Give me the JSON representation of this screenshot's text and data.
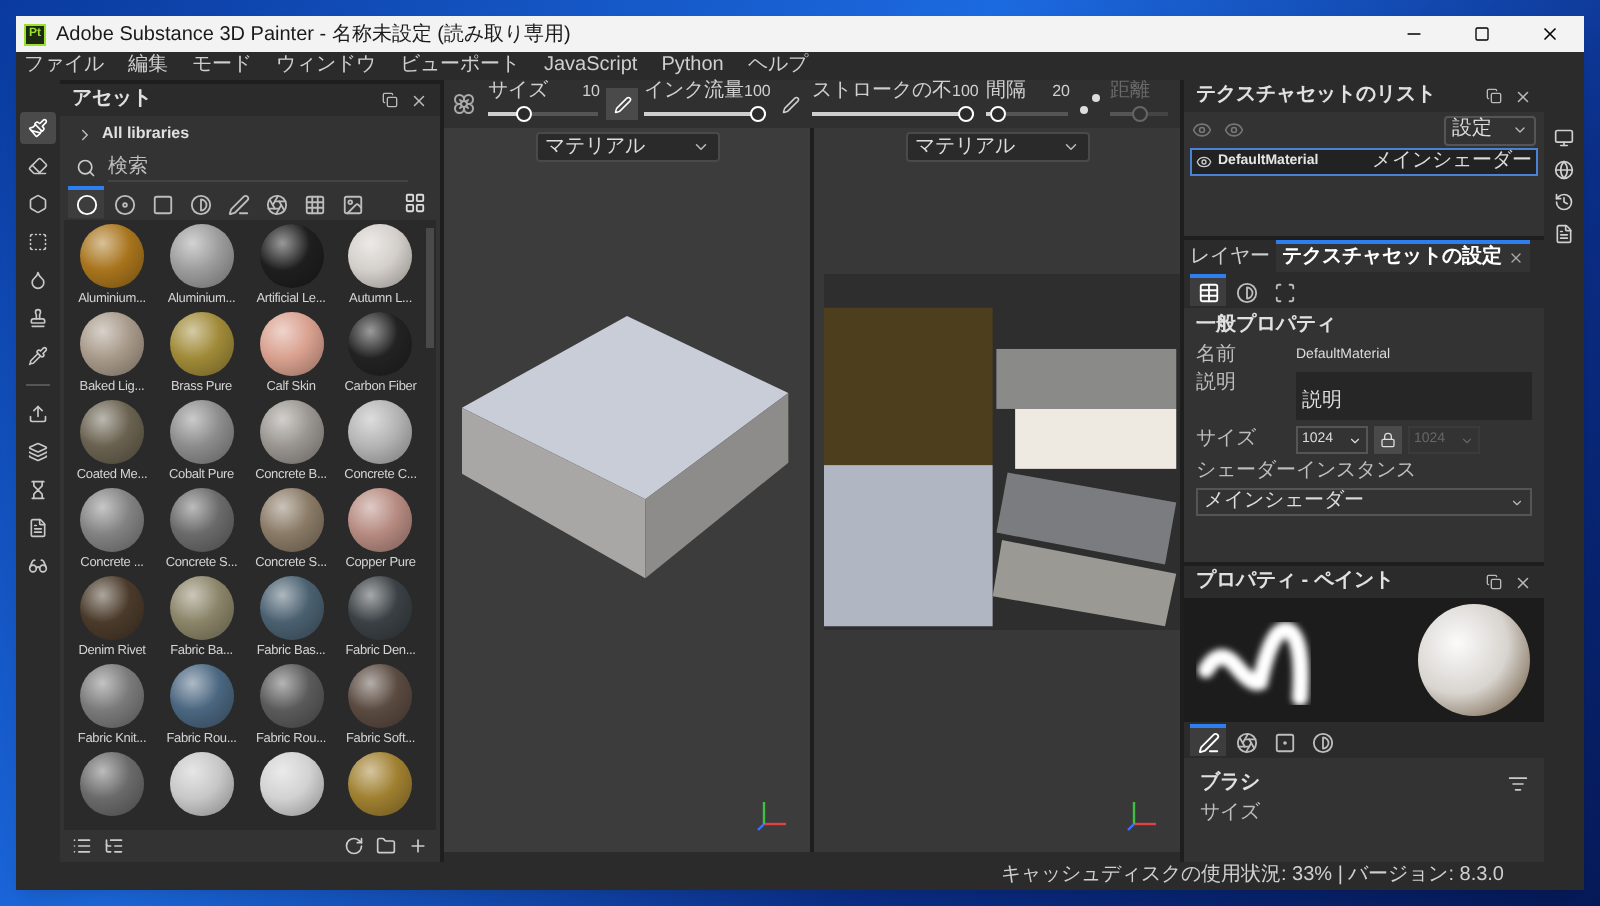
{
  "window": {
    "logo": "Pt",
    "title": "Adobe Substance 3D Painter - 名称未設定 (読み取り専用)"
  },
  "menu": [
    "ファイル",
    "編集",
    "モード",
    "ウィンドウ",
    "ビューポート",
    "JavaScript",
    "Python",
    "ヘルプ"
  ],
  "tools": [
    {
      "kind": "brush",
      "selected": true
    },
    {
      "kind": "eraser",
      "selected": false
    },
    {
      "kind": "projection",
      "selected": false
    },
    {
      "kind": "polygon_fill",
      "selected": false
    },
    {
      "kind": "smudge",
      "selected": false
    },
    {
      "kind": "clone",
      "selected": false
    },
    {
      "kind": "picker",
      "selected": false
    },
    {
      "kind": "separator"
    },
    {
      "kind": "export",
      "selected": false
    },
    {
      "kind": "bake",
      "selected": false
    },
    {
      "kind": "history",
      "selected": false
    },
    {
      "kind": "file",
      "selected": false
    },
    {
      "kind": "glasses",
      "selected": false
    }
  ],
  "tool_options": [
    {
      "kind": "preset"
    },
    {
      "kind": "slider",
      "label": "サイズ",
      "value": "10",
      "level": 0.3,
      "disabled": false
    },
    {
      "kind": "pen",
      "on": true
    },
    {
      "kind": "slider",
      "label": "インク流量",
      "value": "100",
      "level": 1,
      "disabled": false
    },
    {
      "kind": "pen",
      "on": false
    },
    {
      "kind": "slider",
      "label": "ストロークの不",
      "value": "100",
      "level": 1,
      "disabled": false
    },
    {
      "kind": "slider",
      "label": "間隔",
      "value": "20",
      "level": 0.05,
      "disabled": false
    },
    {
      "kind": "dots"
    },
    {
      "kind": "slider",
      "label": "距離",
      "level": 0.5,
      "disabled": true
    }
  ],
  "assets": {
    "title": "アセット",
    "library": "All libraries",
    "search": {
      "placeholder": "検索"
    },
    "filters": [
      {
        "kind": "sphere",
        "selected": true
      },
      {
        "kind": "disc",
        "selected": false
      },
      {
        "kind": "square",
        "selected": false
      },
      {
        "kind": "contrast",
        "selected": false
      },
      {
        "kind": "pen",
        "selected": false
      },
      {
        "kind": "aperture",
        "selected": false
      },
      {
        "kind": "grid",
        "selected": false
      },
      {
        "kind": "image",
        "selected": false
      }
    ],
    "materials": [
      {
        "name": "Aluminium...",
        "color": "#a8741c"
      },
      {
        "name": "Aluminium...",
        "color": "#9c9c9c"
      },
      {
        "name": "Artificial Le...",
        "color": "#1e1e1e"
      },
      {
        "name": "Autumn L...",
        "color": "#d4cfca"
      },
      {
        "name": "Baked Lig...",
        "color": "#a89a8a"
      },
      {
        "name": "Brass Pure",
        "color": "#a08a38"
      },
      {
        "name": "Calf Skin",
        "color": "#d9a08e"
      },
      {
        "name": "Carbon Fiber",
        "color": "#222222"
      },
      {
        "name": "Coated Me...",
        "color": "#6a6250"
      },
      {
        "name": "Cobalt Pure",
        "color": "#8c8c8c"
      },
      {
        "name": "Concrete B...",
        "color": "#9a9590"
      },
      {
        "name": "Concrete C...",
        "color": "#b4b4b4"
      },
      {
        "name": "Concrete ...",
        "color": "#828282"
      },
      {
        "name": "Concrete S...",
        "color": "#6a6a6a"
      },
      {
        "name": "Concrete S...",
        "color": "#8a7a66"
      },
      {
        "name": "Copper Pure",
        "color": "#b68a80"
      },
      {
        "name": "Denim Rivet",
        "color": "#4a3a2a"
      },
      {
        "name": "Fabric Ba...",
        "color": "#8a8468"
      },
      {
        "name": "Fabric Bas...",
        "color": "#4a6070"
      },
      {
        "name": "Fabric Den...",
        "color": "#3a4044"
      },
      {
        "name": "Fabric Knit...",
        "color": "#7a7a7a"
      },
      {
        "name": "Fabric Rou...",
        "color": "#4a6680"
      },
      {
        "name": "Fabric Rou...",
        "color": "#5a5a5a"
      },
      {
        "name": "Fabric Soft...",
        "color": "#5a4a40"
      },
      {
        "color": "#6a6a6a"
      },
      {
        "color": "#c8c8c8"
      },
      {
        "color": "#d2d2d2"
      },
      {
        "color": "#a08030"
      }
    ]
  },
  "viewports": [
    {
      "kind": "model",
      "mode": "マテリアル"
    },
    {
      "kind": "uv",
      "mode": "マテリアル"
    }
  ],
  "texture_set_list": {
    "title": "テクスチャセットのリスト",
    "settings": "設定",
    "items": [
      {
        "name": "DefaultMaterial",
        "shader": "メインシェーダー",
        "selected": true
      }
    ]
  },
  "settings_panel": {
    "tabs": [
      {
        "label": "レイヤー",
        "selected": false,
        "closable": false
      },
      {
        "label": "テクスチャセットの設定",
        "selected": true,
        "closable": true
      }
    ],
    "icon_tabs": [
      {
        "kind": "sheet",
        "selected": true
      },
      {
        "kind": "contrast",
        "selected": false
      },
      {
        "kind": "frame",
        "selected": false
      }
    ],
    "section": "一般プロパティ",
    "name_label": "名前",
    "name_value": "DefaultMaterial",
    "description_label": "説明",
    "description_value": "説明",
    "size_label": "サイズ",
    "sizes": [
      {
        "value": "1024",
        "disabled": false
      },
      {
        "value": "1024",
        "disabled": true
      }
    ],
    "shader_label": "シェーダーインスタンス",
    "shader_value": "メインシェーダー"
  },
  "paint_panel": {
    "title": "プロパティ - ペイント",
    "icon_tabs": [
      {
        "kind": "pen",
        "selected": true
      },
      {
        "kind": "aperture",
        "selected": false
      },
      {
        "kind": "square",
        "selected": false
      },
      {
        "kind": "contrast",
        "selected": false
      }
    ],
    "section": "ブラシ",
    "size_label": "サイズ"
  },
  "status_bar": "キャッシュディスクの使用状況: 33% | バージョン: 8.3.0"
}
